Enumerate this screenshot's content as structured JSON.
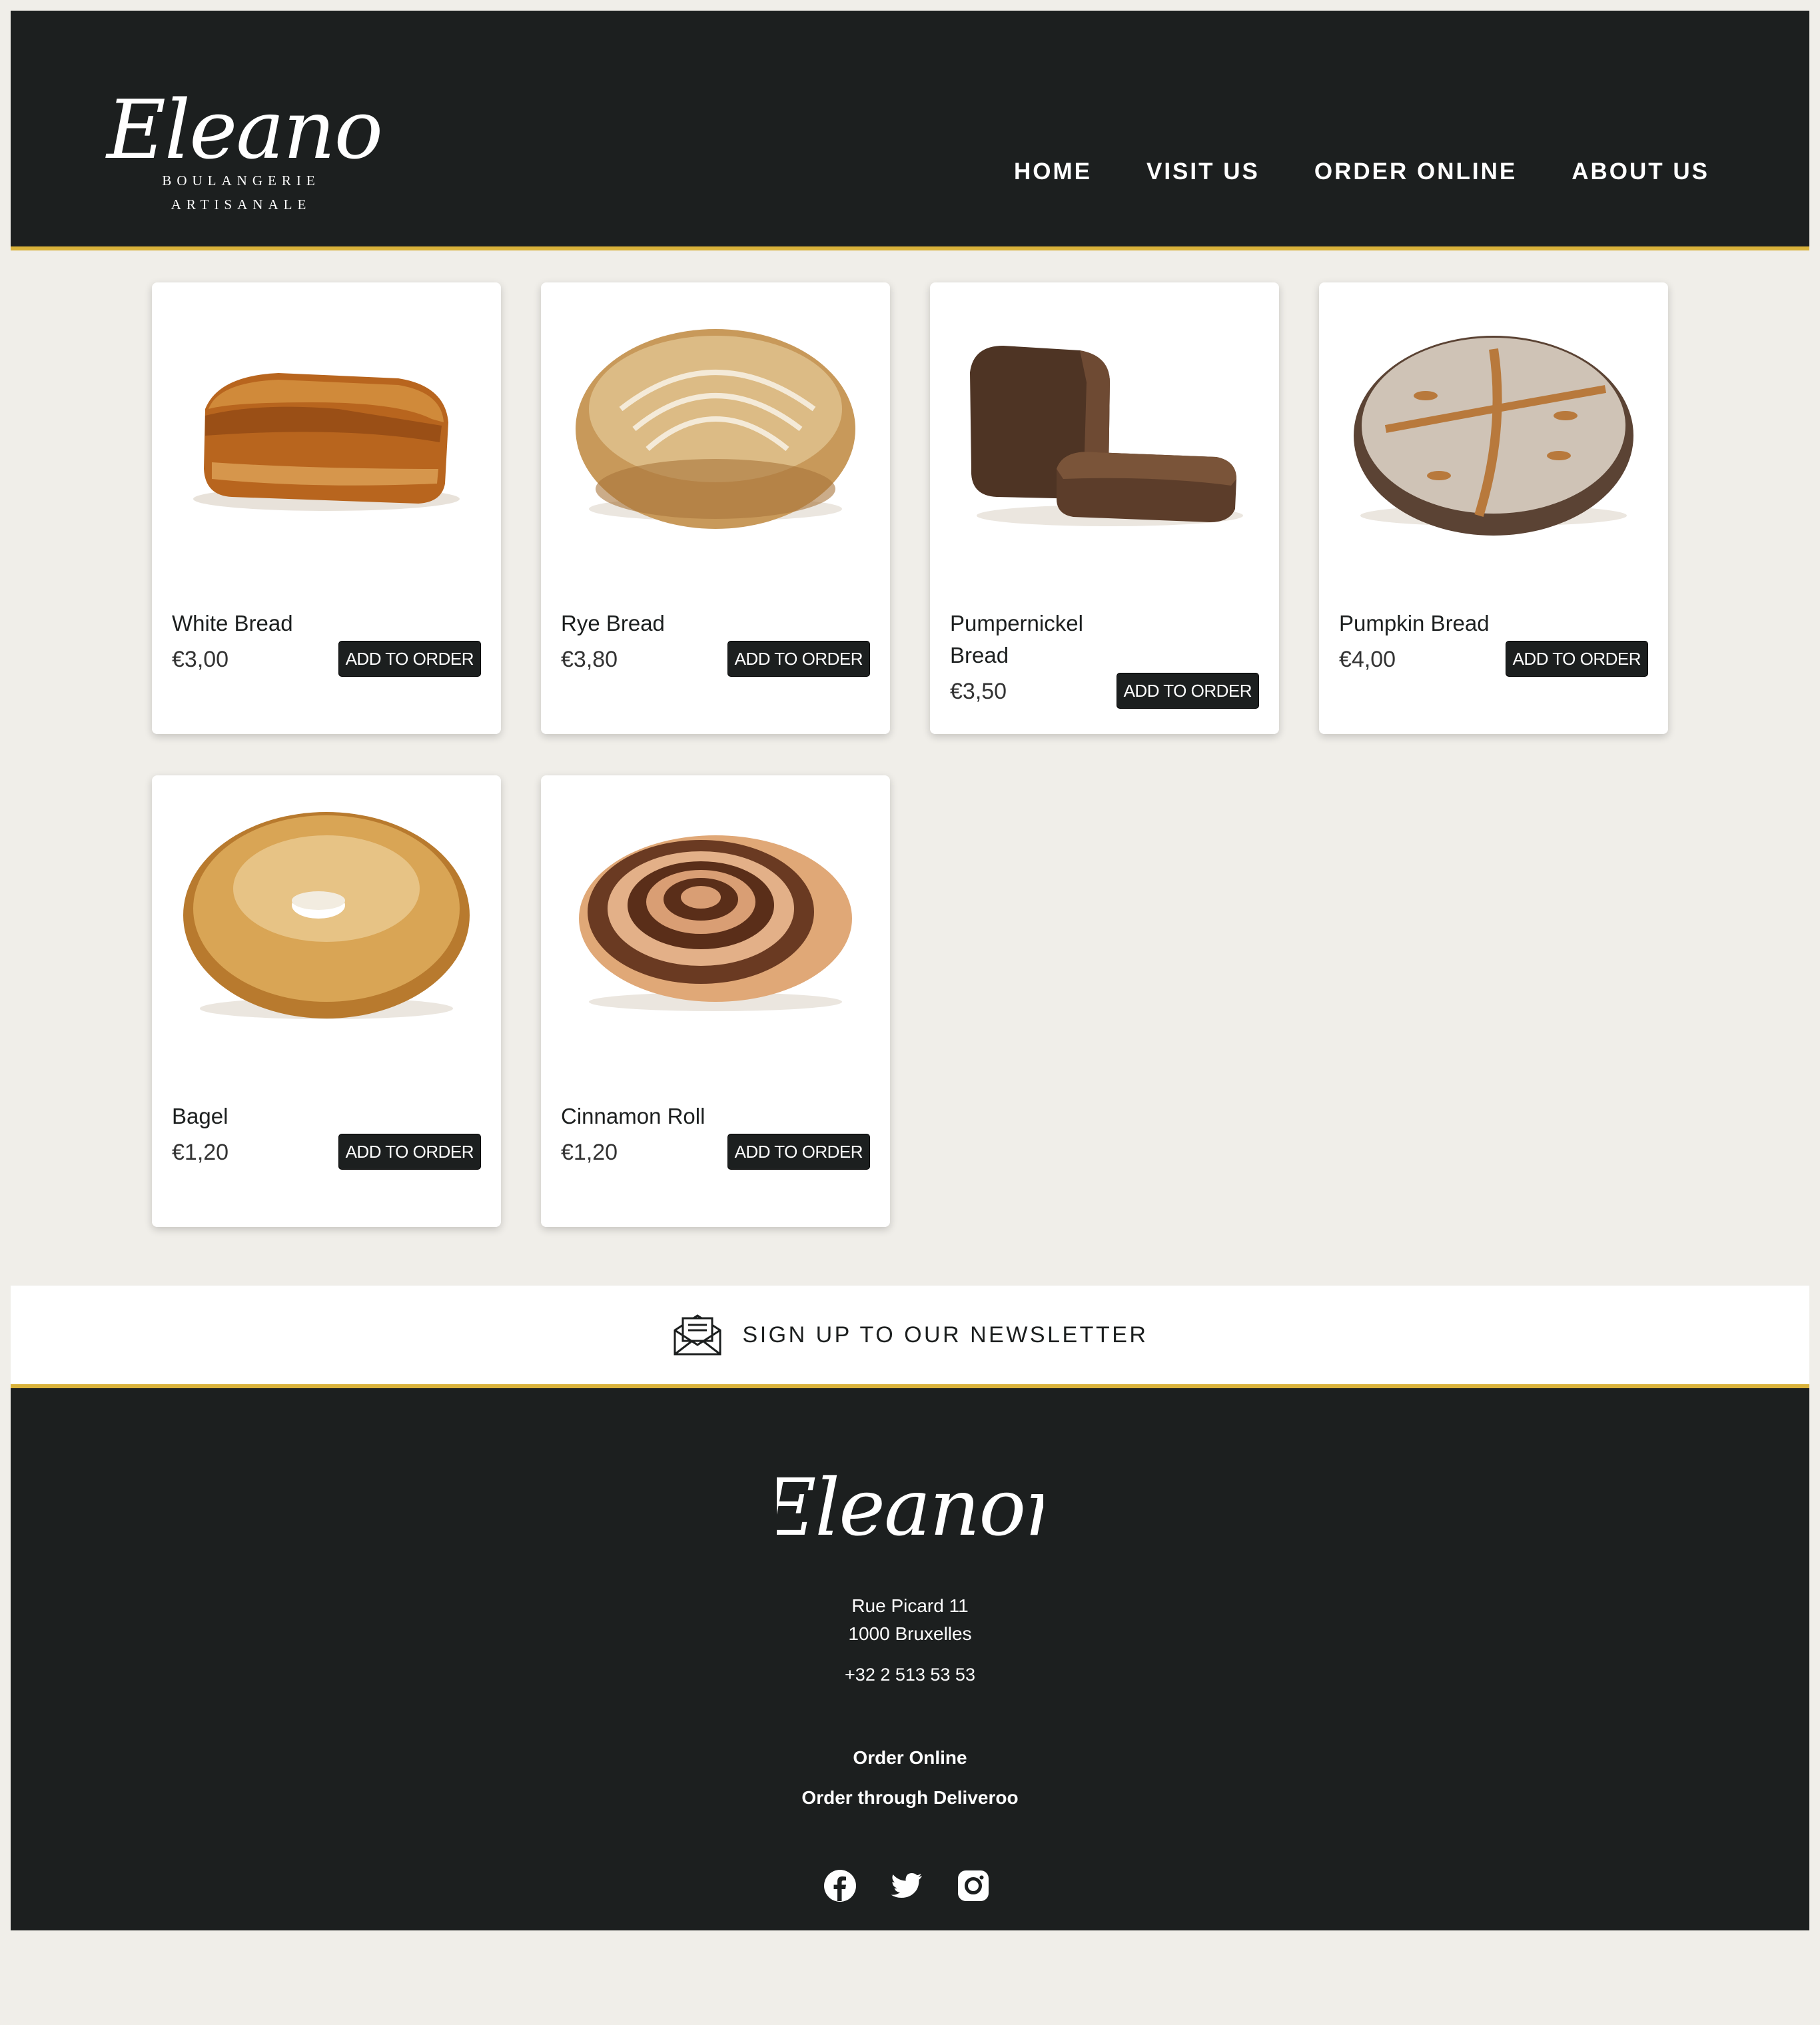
{
  "brand": {
    "name": "Eleanor",
    "tagline_1": "BOULANGERIE",
    "tagline_2": "ARTISANALE"
  },
  "nav": {
    "items": [
      {
        "label": "HOME"
      },
      {
        "label": "VISIT US"
      },
      {
        "label": "ORDER ONLINE"
      },
      {
        "label": "ABOUT US"
      }
    ]
  },
  "products": [
    {
      "name": "White Bread",
      "price": "€3,00",
      "button": "ADD TO ORDER",
      "image": "white-bread"
    },
    {
      "name": "Rye Bread",
      "price": "€3,80",
      "button": "ADD TO ORDER",
      "image": "rye-bread"
    },
    {
      "name": "Pumpernickel Bread",
      "price": "€3,50",
      "button": "ADD TO ORDER",
      "image": "pumpernickel-bread"
    },
    {
      "name": "Pumpkin Bread",
      "price": "€4,00",
      "button": "ADD TO ORDER",
      "image": "pumpkin-bread"
    },
    {
      "name": "Bagel",
      "price": "€1,20",
      "button": "ADD TO ORDER",
      "image": "bagel"
    },
    {
      "name": "Cinnamon Roll",
      "price": "€1,20",
      "button": "ADD TO ORDER",
      "image": "cinnamon-roll"
    }
  ],
  "newsletter": {
    "icon": "envelope-icon",
    "label": "SIGN UP TO OUR NEWSLETTER"
  },
  "footer": {
    "logo": "Eleanor",
    "address_line_1": "Rue Picard 11",
    "address_line_2": "1000 Bruxelles",
    "phone": "+32 2 513 53 53",
    "links": [
      {
        "label": "Order Online"
      },
      {
        "label": "Order through Deliveroo"
      }
    ],
    "social": [
      "facebook-icon",
      "twitter-icon",
      "instagram-icon"
    ]
  },
  "colors": {
    "dark": "#1c1f1f",
    "accent": "#d9b23a",
    "background": "#f0eee9",
    "card": "#ffffff"
  }
}
